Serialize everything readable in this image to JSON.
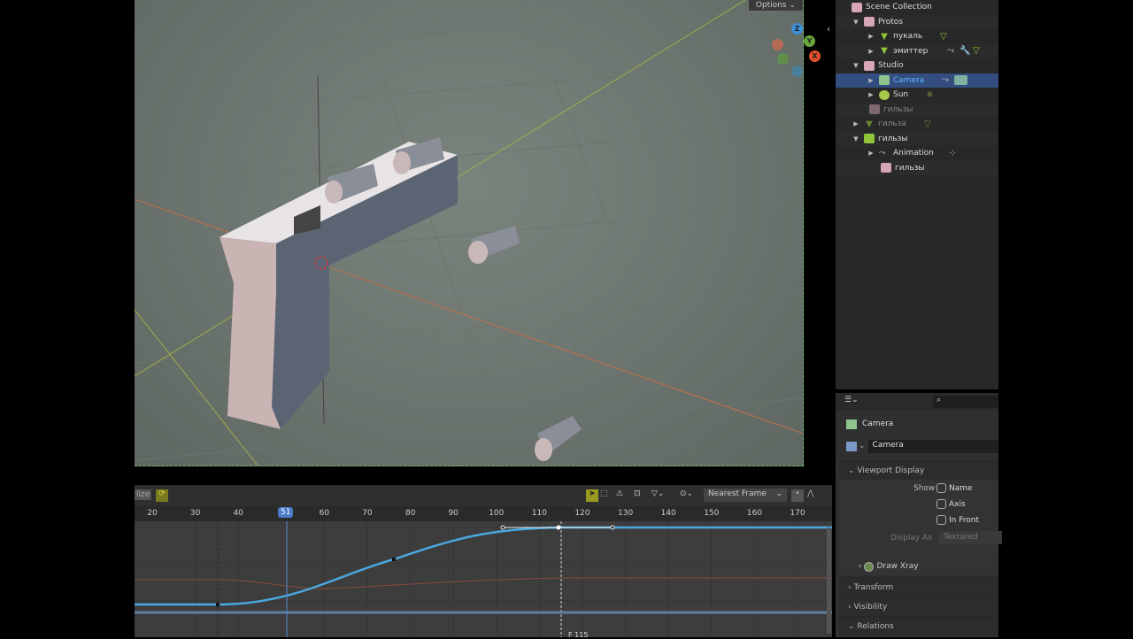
{
  "viewport": {
    "options_label": "Options",
    "gizmo": {
      "z": "Z",
      "y": "Y",
      "x": "X"
    }
  },
  "outliner": {
    "rows": [
      {
        "label": "Scene Collection",
        "icon": "collection-icon"
      },
      {
        "label": "Protos",
        "icon": "collection-icon"
      },
      {
        "label": "пукаль",
        "icon": "mesh-icon"
      },
      {
        "label": "эмиттер",
        "icon": "mesh-icon"
      },
      {
        "label": "Studio",
        "icon": "collection-icon"
      },
      {
        "label": "Camera",
        "icon": "camera-icon"
      },
      {
        "label": "Sun",
        "icon": "light-icon"
      },
      {
        "label": "гильзы",
        "icon": "collection-icon"
      },
      {
        "label": "гильза",
        "icon": "mesh-icon"
      },
      {
        "label": "гильзы",
        "icon": "collection-icon"
      },
      {
        "label": "Animation",
        "icon": "animation-icon"
      },
      {
        "label": "гильзы",
        "icon": "collection-icon"
      }
    ]
  },
  "properties": {
    "object_name": "Camera",
    "data_name": "Camera",
    "viewport_display": "Viewport Display",
    "show_label": "Show",
    "name": "Name",
    "axis": "Axis",
    "in_front": "In Front",
    "display_as_label": "Display As",
    "display_as_value": "Textured",
    "draw_xray": "Draw Xray",
    "transform": "Transform",
    "visibility": "Visibility",
    "relations": "Relations"
  },
  "graph": {
    "normalize_label": "lize",
    "snap_mode": "Nearest Frame",
    "current_frame": "51",
    "cursor_label": "F 115",
    "ticks": [
      "20",
      "30",
      "40",
      "60",
      "70",
      "80",
      "90",
      "100",
      "110",
      "120",
      "130",
      "140",
      "150",
      "160",
      "170"
    ]
  }
}
